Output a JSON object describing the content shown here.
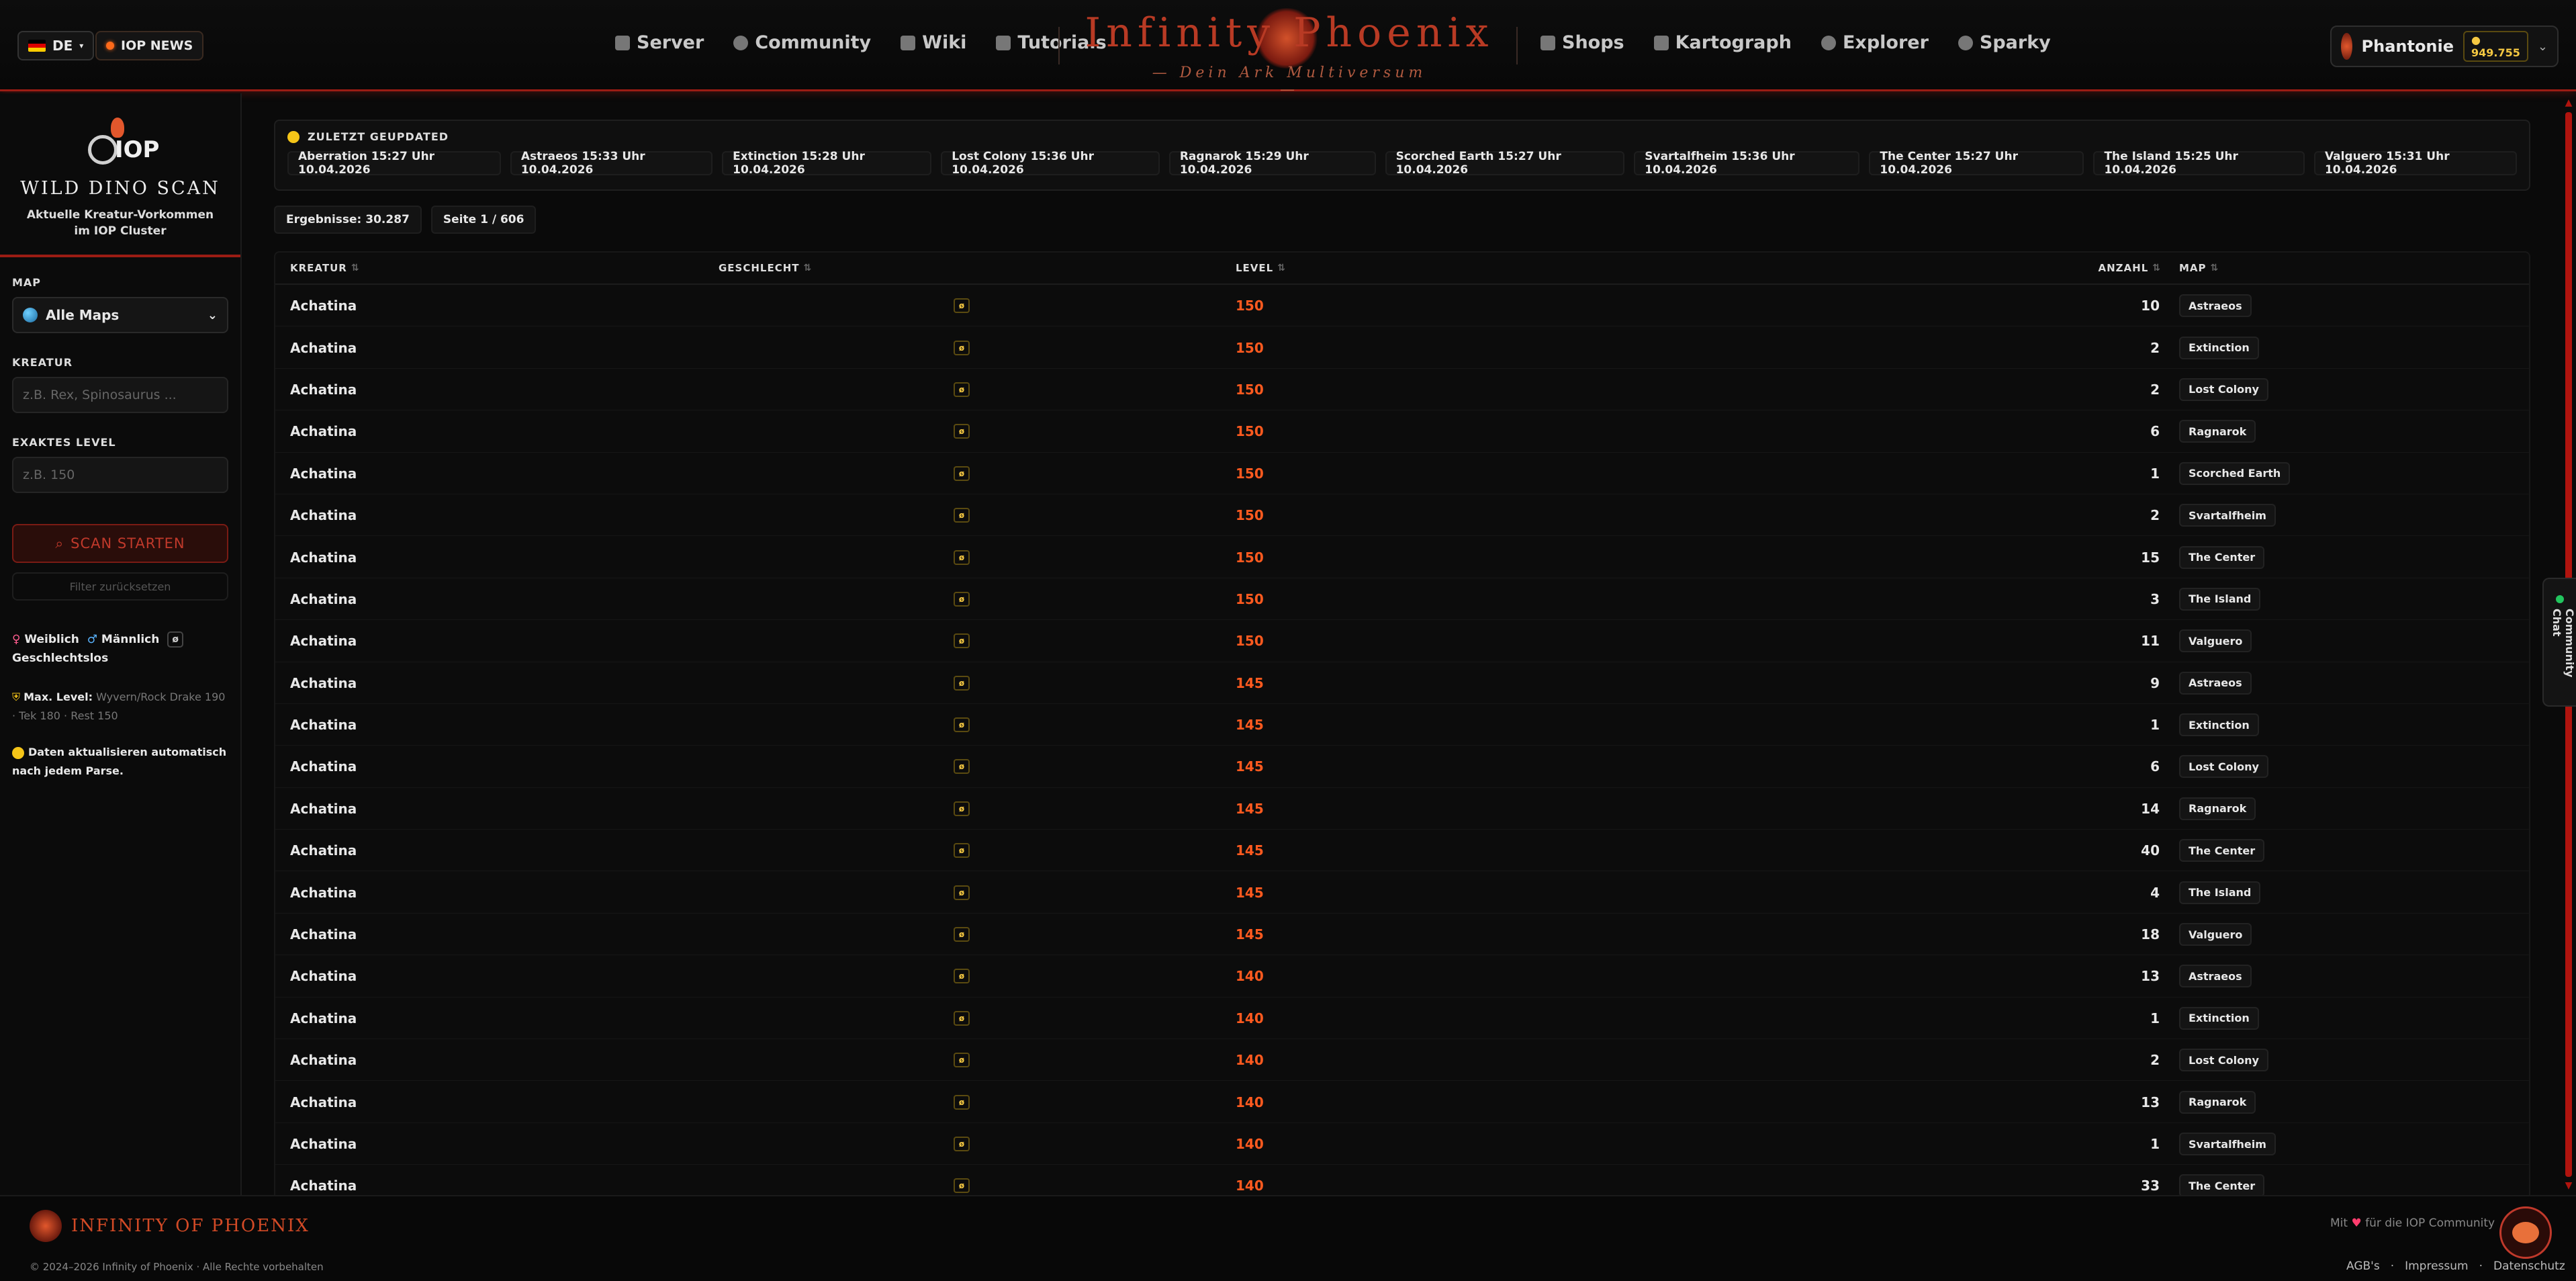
{
  "header": {
    "lang": "DE",
    "news": "IOP NEWS",
    "nav_left": [
      {
        "label": "Server",
        "icon": "server-icon"
      },
      {
        "label": "Community",
        "icon": "users-icon"
      },
      {
        "label": "Wiki",
        "icon": "book-icon"
      },
      {
        "label": "Tutorials",
        "icon": "document-icon"
      }
    ],
    "nav_right": [
      {
        "label": "Shops",
        "icon": "cart-icon"
      },
      {
        "label": "Kartograph",
        "icon": "map-icon"
      },
      {
        "label": "Explorer",
        "icon": "compass-icon"
      },
      {
        "label": "Sparky",
        "icon": "sparky-icon"
      }
    ],
    "logo_title": "Infinity  Phoenix",
    "logo_subtitle": "Dein Ark Multiversum",
    "user": {
      "name": "Phantonie",
      "coins": "949.755"
    }
  },
  "sidebar": {
    "brand_title": "WILD DINO SCAN",
    "brand_sub_1": "Aktuelle Kreatur-Vorkommen",
    "brand_sub_2": "im IOP Cluster",
    "iop_text": "IOP",
    "map_label": "MAP",
    "map_value": "Alle Maps",
    "creature_label": "KREATUR",
    "creature_placeholder": "z.B. Rex, Spinosaurus ...",
    "level_label": "EXAKTES LEVEL",
    "level_placeholder": "z.B. 150",
    "scan_button": "SCAN STARTEN",
    "reset_button": "Filter zurücksetzen",
    "legend_female": "Weiblich",
    "legend_male": "Männlich",
    "legend_none": "Geschlechtslos",
    "legend_none_symbol": "ø",
    "maxlevel_title": "Max. Level:",
    "maxlevel_text": "Wyvern/Rock Drake 190 · Tek 180 · Rest 150",
    "auto_update": "Daten aktualisieren automatisch nach jedem Parse."
  },
  "updates": {
    "title": "ZULETZT GEUPDATED",
    "items": [
      "Aberration 15:27 Uhr 10.04.2026",
      "Astraeos 15:33 Uhr 10.04.2026",
      "Extinction 15:28 Uhr 10.04.2026",
      "Lost Colony 15:36 Uhr 10.04.2026",
      "Ragnarok 15:29 Uhr 10.04.2026",
      "Scorched Earth 15:27 Uhr 10.04.2026",
      "Svartalfheim 15:36 Uhr 10.04.2026",
      "The Center 15:27 Uhr 10.04.2026",
      "The Island 15:25 Uhr 10.04.2026",
      "Valguero 15:31 Uhr 10.04.2026"
    ]
  },
  "stats": {
    "results": "Ergebnisse: 30.287",
    "page": "Seite 1 / 606"
  },
  "table": {
    "headers": {
      "creature": "KREATUR",
      "gender": "GESCHLECHT",
      "level": "LEVEL",
      "count": "ANZAHL",
      "map": "MAP"
    },
    "rows": [
      {
        "creature": "Achatina",
        "gender": "ø",
        "level": "150",
        "count": "10",
        "map": "Astraeos"
      },
      {
        "creature": "Achatina",
        "gender": "ø",
        "level": "150",
        "count": "2",
        "map": "Extinction"
      },
      {
        "creature": "Achatina",
        "gender": "ø",
        "level": "150",
        "count": "2",
        "map": "Lost Colony"
      },
      {
        "creature": "Achatina",
        "gender": "ø",
        "level": "150",
        "count": "6",
        "map": "Ragnarok"
      },
      {
        "creature": "Achatina",
        "gender": "ø",
        "level": "150",
        "count": "1",
        "map": "Scorched Earth"
      },
      {
        "creature": "Achatina",
        "gender": "ø",
        "level": "150",
        "count": "2",
        "map": "Svartalfheim"
      },
      {
        "creature": "Achatina",
        "gender": "ø",
        "level": "150",
        "count": "15",
        "map": "The Center"
      },
      {
        "creature": "Achatina",
        "gender": "ø",
        "level": "150",
        "count": "3",
        "map": "The Island"
      },
      {
        "creature": "Achatina",
        "gender": "ø",
        "level": "150",
        "count": "11",
        "map": "Valguero"
      },
      {
        "creature": "Achatina",
        "gender": "ø",
        "level": "145",
        "count": "9",
        "map": "Astraeos"
      },
      {
        "creature": "Achatina",
        "gender": "ø",
        "level": "145",
        "count": "1",
        "map": "Extinction"
      },
      {
        "creature": "Achatina",
        "gender": "ø",
        "level": "145",
        "count": "6",
        "map": "Lost Colony"
      },
      {
        "creature": "Achatina",
        "gender": "ø",
        "level": "145",
        "count": "14",
        "map": "Ragnarok"
      },
      {
        "creature": "Achatina",
        "gender": "ø",
        "level": "145",
        "count": "40",
        "map": "The Center"
      },
      {
        "creature": "Achatina",
        "gender": "ø",
        "level": "145",
        "count": "4",
        "map": "The Island"
      },
      {
        "creature": "Achatina",
        "gender": "ø",
        "level": "145",
        "count": "18",
        "map": "Valguero"
      },
      {
        "creature": "Achatina",
        "gender": "ø",
        "level": "140",
        "count": "13",
        "map": "Astraeos"
      },
      {
        "creature": "Achatina",
        "gender": "ø",
        "level": "140",
        "count": "1",
        "map": "Extinction"
      },
      {
        "creature": "Achatina",
        "gender": "ø",
        "level": "140",
        "count": "2",
        "map": "Lost Colony"
      },
      {
        "creature": "Achatina",
        "gender": "ø",
        "level": "140",
        "count": "13",
        "map": "Ragnarok"
      },
      {
        "creature": "Achatina",
        "gender": "ø",
        "level": "140",
        "count": "1",
        "map": "Svartalfheim"
      },
      {
        "creature": "Achatina",
        "gender": "ø",
        "level": "140",
        "count": "33",
        "map": "The Center"
      }
    ]
  },
  "chat": {
    "label": "Community Chat"
  },
  "footer": {
    "brand": "INFINITY OF PHOENIX",
    "copyright": "© 2024–2026 Infinity of Phoenix · Alle Rechte vorbehalten",
    "love_prefix": "Mit",
    "love_suffix": "für die IOP Community",
    "links": [
      "AGB's",
      "Impressum",
      "Datenschutz"
    ]
  },
  "colors": {
    "accent": "#9b1c14",
    "level": "#ff5a1f",
    "brand": "#b83a24",
    "coin": "#f5c842"
  }
}
